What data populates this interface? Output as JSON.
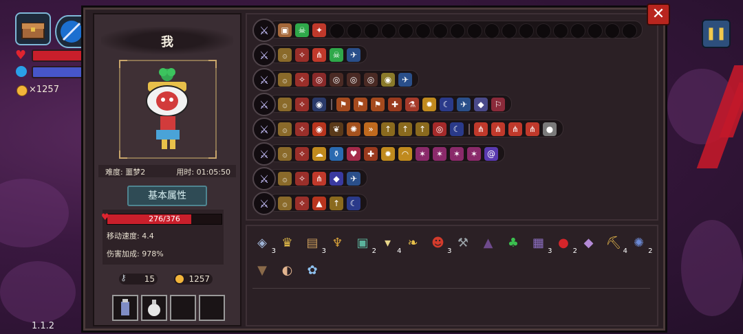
{
  "hud": {
    "gold": "×1257",
    "version": "1.1.2",
    "colors": {
      "hp": "#c91f2b",
      "mana": "#4756c9"
    }
  },
  "panel": {
    "player_name": "我",
    "difficulty": "难度: 噩梦2",
    "time": "用时: 01:05:50",
    "attr_button": "基本属性",
    "hp": "276/376",
    "hp_ratio": 0.734,
    "move_speed": "移动速度: 4.4",
    "damage_bonus": "伤害加成: 978%",
    "keys": "15",
    "coins": "1257"
  },
  "weapon_rows": [
    {
      "weapon": "chest-icon",
      "icons": [
        "chest",
        "skull-green",
        "fire-rune"
      ],
      "empty_slots": 18
    },
    {
      "weapon": "spear-icon",
      "icons": [
        "rune-a",
        "rune-b",
        "claw",
        "skull-green",
        "bird"
      ],
      "empty_slots": 0
    },
    {
      "weapon": "trident-icon",
      "icons": [
        "rune-a",
        "rune-b",
        "ring",
        "ring-dim",
        "ring-dim",
        "ring-dim",
        "eye",
        "bird"
      ],
      "empty_slots": 0
    },
    {
      "weapon": "tome-icon",
      "icons": [
        "rune-a",
        "rune-b",
        "eye-orb",
        "|",
        "boot",
        "boot",
        "boot",
        "cross",
        "flask",
        "sun",
        "moon",
        "bird",
        "gem",
        "banner"
      ],
      "empty_slots": 0
    },
    {
      "weapon": "staff-icon",
      "icons": [
        "rune-a",
        "rune-b",
        "fire-eye",
        "wing",
        "swirl",
        "arrows",
        "arrow-up",
        "arrow-up",
        "arrow-up",
        "target",
        "moon",
        "|",
        "claw",
        "claw",
        "claw",
        "claw",
        "stone"
      ],
      "empty_slots": 0
    },
    {
      "weapon": "scepter-icon",
      "icons": [
        "rune-a",
        "rune-b",
        "cloud",
        "bottle",
        "heart",
        "cross",
        "sun",
        "swipe",
        "pink-star",
        "pink-star",
        "pink-star",
        "pink-star",
        "spiral"
      ],
      "empty_slots": 0
    },
    {
      "weapon": "orb-icon",
      "icons": [
        "rune-a",
        "rune-b",
        "claw",
        "shield-gem",
        "bird"
      ],
      "empty_slots": 0
    },
    {
      "weapon": "orb2-icon",
      "icons": [
        "rune-a",
        "rune-b",
        "fire",
        "arrow-up",
        "moon"
      ],
      "empty_slots": 0
    }
  ],
  "items": [
    {
      "name": "ghost-shield-icon",
      "glyph": "◈",
      "color": "#9fb4d6",
      "count": "3"
    },
    {
      "name": "crown-icon",
      "glyph": "♛",
      "color": "#e8c04a",
      "count": ""
    },
    {
      "name": "scroll-icon",
      "glyph": "▤",
      "color": "#c79a5a",
      "count": "3"
    },
    {
      "name": "goblet-icon",
      "glyph": "♆",
      "color": "#d9a23a",
      "count": ""
    },
    {
      "name": "book-icon",
      "glyph": "▣",
      "color": "#5bb39c",
      "count": "2"
    },
    {
      "name": "teeth-icon",
      "glyph": "▾",
      "color": "#e8d68a",
      "count": "4"
    },
    {
      "name": "feather-icon",
      "glyph": "❧",
      "color": "#e8c04a",
      "count": ""
    },
    {
      "name": "demon-mask-icon",
      "glyph": "☻",
      "color": "#d33b2c",
      "count": "3"
    },
    {
      "name": "hammer-icon",
      "glyph": "⚒",
      "color": "#9aa3a8",
      "count": ""
    },
    {
      "name": "robe-icon",
      "glyph": "▲",
      "color": "#6e4a8c",
      "count": ""
    },
    {
      "name": "clover-icon",
      "glyph": "♣",
      "color": "#3bbf4f",
      "count": ""
    },
    {
      "name": "rune-box-icon",
      "glyph": "▦",
      "color": "#8d6fc4",
      "count": "3"
    },
    {
      "name": "red-gem-icon",
      "glyph": "●",
      "color": "#d4252a",
      "count": "2"
    },
    {
      "name": "diamond-icon",
      "glyph": "◆",
      "color": "#b48ad6",
      "count": ""
    },
    {
      "name": "pickaxe-icon",
      "glyph": "⛏",
      "color": "#e0b34a",
      "count": "4"
    },
    {
      "name": "squid-icon",
      "glyph": "✺",
      "color": "#6c8ad6",
      "count": "2"
    },
    {
      "name": "cloak-icon",
      "glyph": "▼",
      "color": "#8a6a4a",
      "count": ""
    },
    {
      "name": "ear-icon",
      "glyph": "◐",
      "color": "#e2b48f",
      "count": ""
    },
    {
      "name": "blue-flower-icon",
      "glyph": "✿",
      "color": "#8ec1ef",
      "count": ""
    }
  ]
}
